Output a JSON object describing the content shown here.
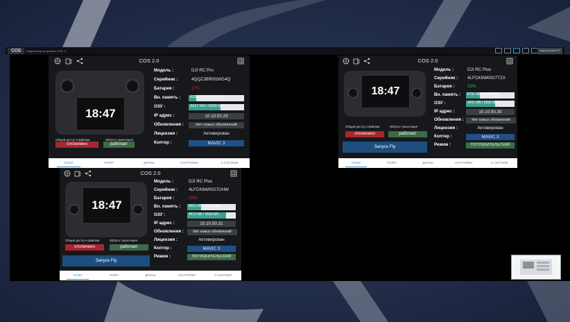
{
  "window": {
    "logo": "COS",
    "title": "Подключено устройств COS: 3",
    "right_button": "Закрыть режим TV"
  },
  "panes": [
    {
      "header_title": "COS 2.0",
      "time": "18:47",
      "share_files_label": "Общий доступ к файлам",
      "wiopt_label": "WiOpt и трансляция",
      "share_files_status": "отключено",
      "wiopt_status": "работает",
      "launch_label": "",
      "info": {
        "model_k": "Модель :",
        "model_v": "DJI RC Pro",
        "serial_k": "Серийник :",
        "serial_v": "4QQZJBR0030G4Q",
        "battery_k": "Батарея :",
        "battery_v": "17%",
        "storage_k": "Вн. память :",
        "storage_v": "4253 Мб / 30500 Мб",
        "storage_pct": 0.14,
        "ram_k": "ОЗУ :",
        "ram_v": "3317 Мб / 5690 Мб",
        "ram_pct": 0.58,
        "ip_k": "IP адрес :",
        "ip_v": "10.10.50.29",
        "updates_k": "Обновления :",
        "updates_v": "Нет новых обновлений",
        "license_k": "Лицензия :",
        "license_v": "Активирован",
        "drone_k": "Коптер :",
        "drone_v": "MAVIC 3",
        "mode_k": "",
        "mode_v": ""
      },
      "nav": [
        "ПУЛЬТ",
        "ПОЛЁТ",
        "ДРОНЫ",
        "НАСТРОЙКИ",
        "О СИСТЕМЕ"
      ]
    },
    {
      "header_title": "COS 2.0",
      "time": "18:47",
      "share_files_label": "Общий доступ к файлам",
      "wiopt_label": "WiOpt и трансляция",
      "share_files_status": "отключено",
      "wiopt_status": "работает",
      "launch_label": "Запуск Fly",
      "info": {
        "model_k": "Модель :",
        "model_v": "DJI RC Plus",
        "serial_k": "Серийник :",
        "serial_v": "4LFCK6W0027TZX",
        "battery_k": "Батарея :",
        "battery_v": "33%",
        "storage_k": "Вн. память :",
        "storage_v": "8791 Мб / 30500 Мб",
        "storage_pct": 0.29,
        "ram_k": "ОЗУ :",
        "ram_v": "3431 Мб / 5690 Мб",
        "ram_pct": 0.6,
        "ip_k": "IP адрес :",
        "ip_v": "10.10.50.30",
        "updates_k": "Обновления :",
        "updates_v": "Нет новых обновлений",
        "license_k": "Лицензия :",
        "license_v": "Активирован",
        "drone_k": "Коптер :",
        "drone_v": "MAVIC 3",
        "mode_k": "Режим :",
        "mode_v": "ПОТРЕБИТЕЛЬСКИЙ"
      },
      "nav": [
        "ПУЛЬТ",
        "ПОЛЁТ",
        "ДРОНЫ",
        "НАСТРОЙКИ",
        "О СИСТЕМЕ"
      ]
    },
    {
      "header_title": "COS 2.0",
      "time": "18:47",
      "share_files_label": "Общий доступ к файлам",
      "wiopt_label": "WiOpt и трансляция",
      "share_files_status": "отключено",
      "wiopt_status": "работает",
      "launch_label": "Запуск Fly",
      "info": {
        "model_k": "Модель :",
        "model_v": "DJI RC Plus",
        "serial_k": "Серийник :",
        "serial_v": "4LFCK6W0027UHW",
        "battery_k": "Батарея :",
        "battery_v": "28%",
        "storage_k": "Вн. память :",
        "storage_v": "8921 Мб / 30500 Мб",
        "storage_pct": 0.29,
        "ram_k": "ОЗУ :",
        "ram_v": "4572 Мб / 5690 Мб",
        "ram_pct": 0.8,
        "ip_k": "IP адрес :",
        "ip_v": "10.10.50.31",
        "updates_k": "Обновления :",
        "updates_v": "Нет новых обновлений",
        "license_k": "Лицензия :",
        "license_v": "Активирован",
        "drone_k": "Коптер :",
        "drone_v": "MAVIC 3",
        "mode_k": "Режим :",
        "mode_v": "ПОТРЕБИТЕЛЬСКИЙ"
      },
      "nav": [
        "ПУЛЬТ",
        "ПОЛЁТ",
        "ДРОНЫ",
        "НАСТРОЙКИ",
        "О СИСТЕМЕ"
      ]
    }
  ],
  "colors": {
    "battery_low": "#d2232a",
    "battery_ok": "#2fae57",
    "accent": "#2f8fd8"
  }
}
